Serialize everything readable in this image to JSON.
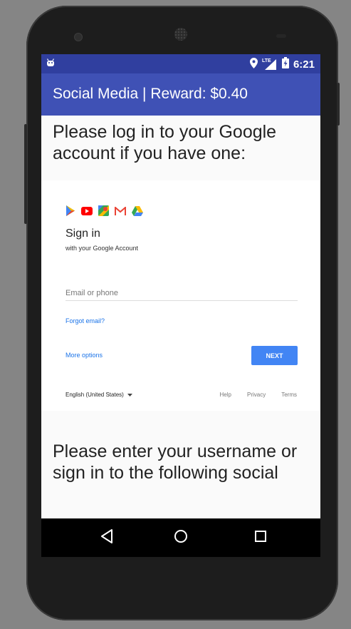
{
  "status_bar": {
    "time": "6:21",
    "network": "LTE",
    "icons": [
      "android-debug-icon",
      "location-icon",
      "signal-icon",
      "battery-icon"
    ]
  },
  "app_bar": {
    "title": "Social Media | Reward: $0.40"
  },
  "main": {
    "prompt_google": "Please log in to your Google account if you have one:",
    "prompt_social": "Please enter your username or sign in to the following social"
  },
  "google_signin": {
    "product_icons": [
      "play-store-icon",
      "youtube-icon",
      "maps-icon",
      "gmail-icon",
      "drive-icon"
    ],
    "title": "Sign in",
    "subtitle": "with your Google Account",
    "email_placeholder": "Email or phone",
    "email_value": "",
    "forgot_email": "Forgot email?",
    "more_options": "More options",
    "next_button": "NEXT",
    "language": "English (United States)",
    "footer_links": {
      "help": "Help",
      "privacy": "Privacy",
      "terms": "Terms"
    }
  },
  "nav_bar": {
    "icons": [
      "back-icon",
      "home-icon",
      "recents-icon"
    ]
  },
  "colors": {
    "status_bar": "#303f9f",
    "app_bar": "#3f51b5",
    "link_blue": "#1a73e8",
    "next_button": "#4285f4"
  }
}
